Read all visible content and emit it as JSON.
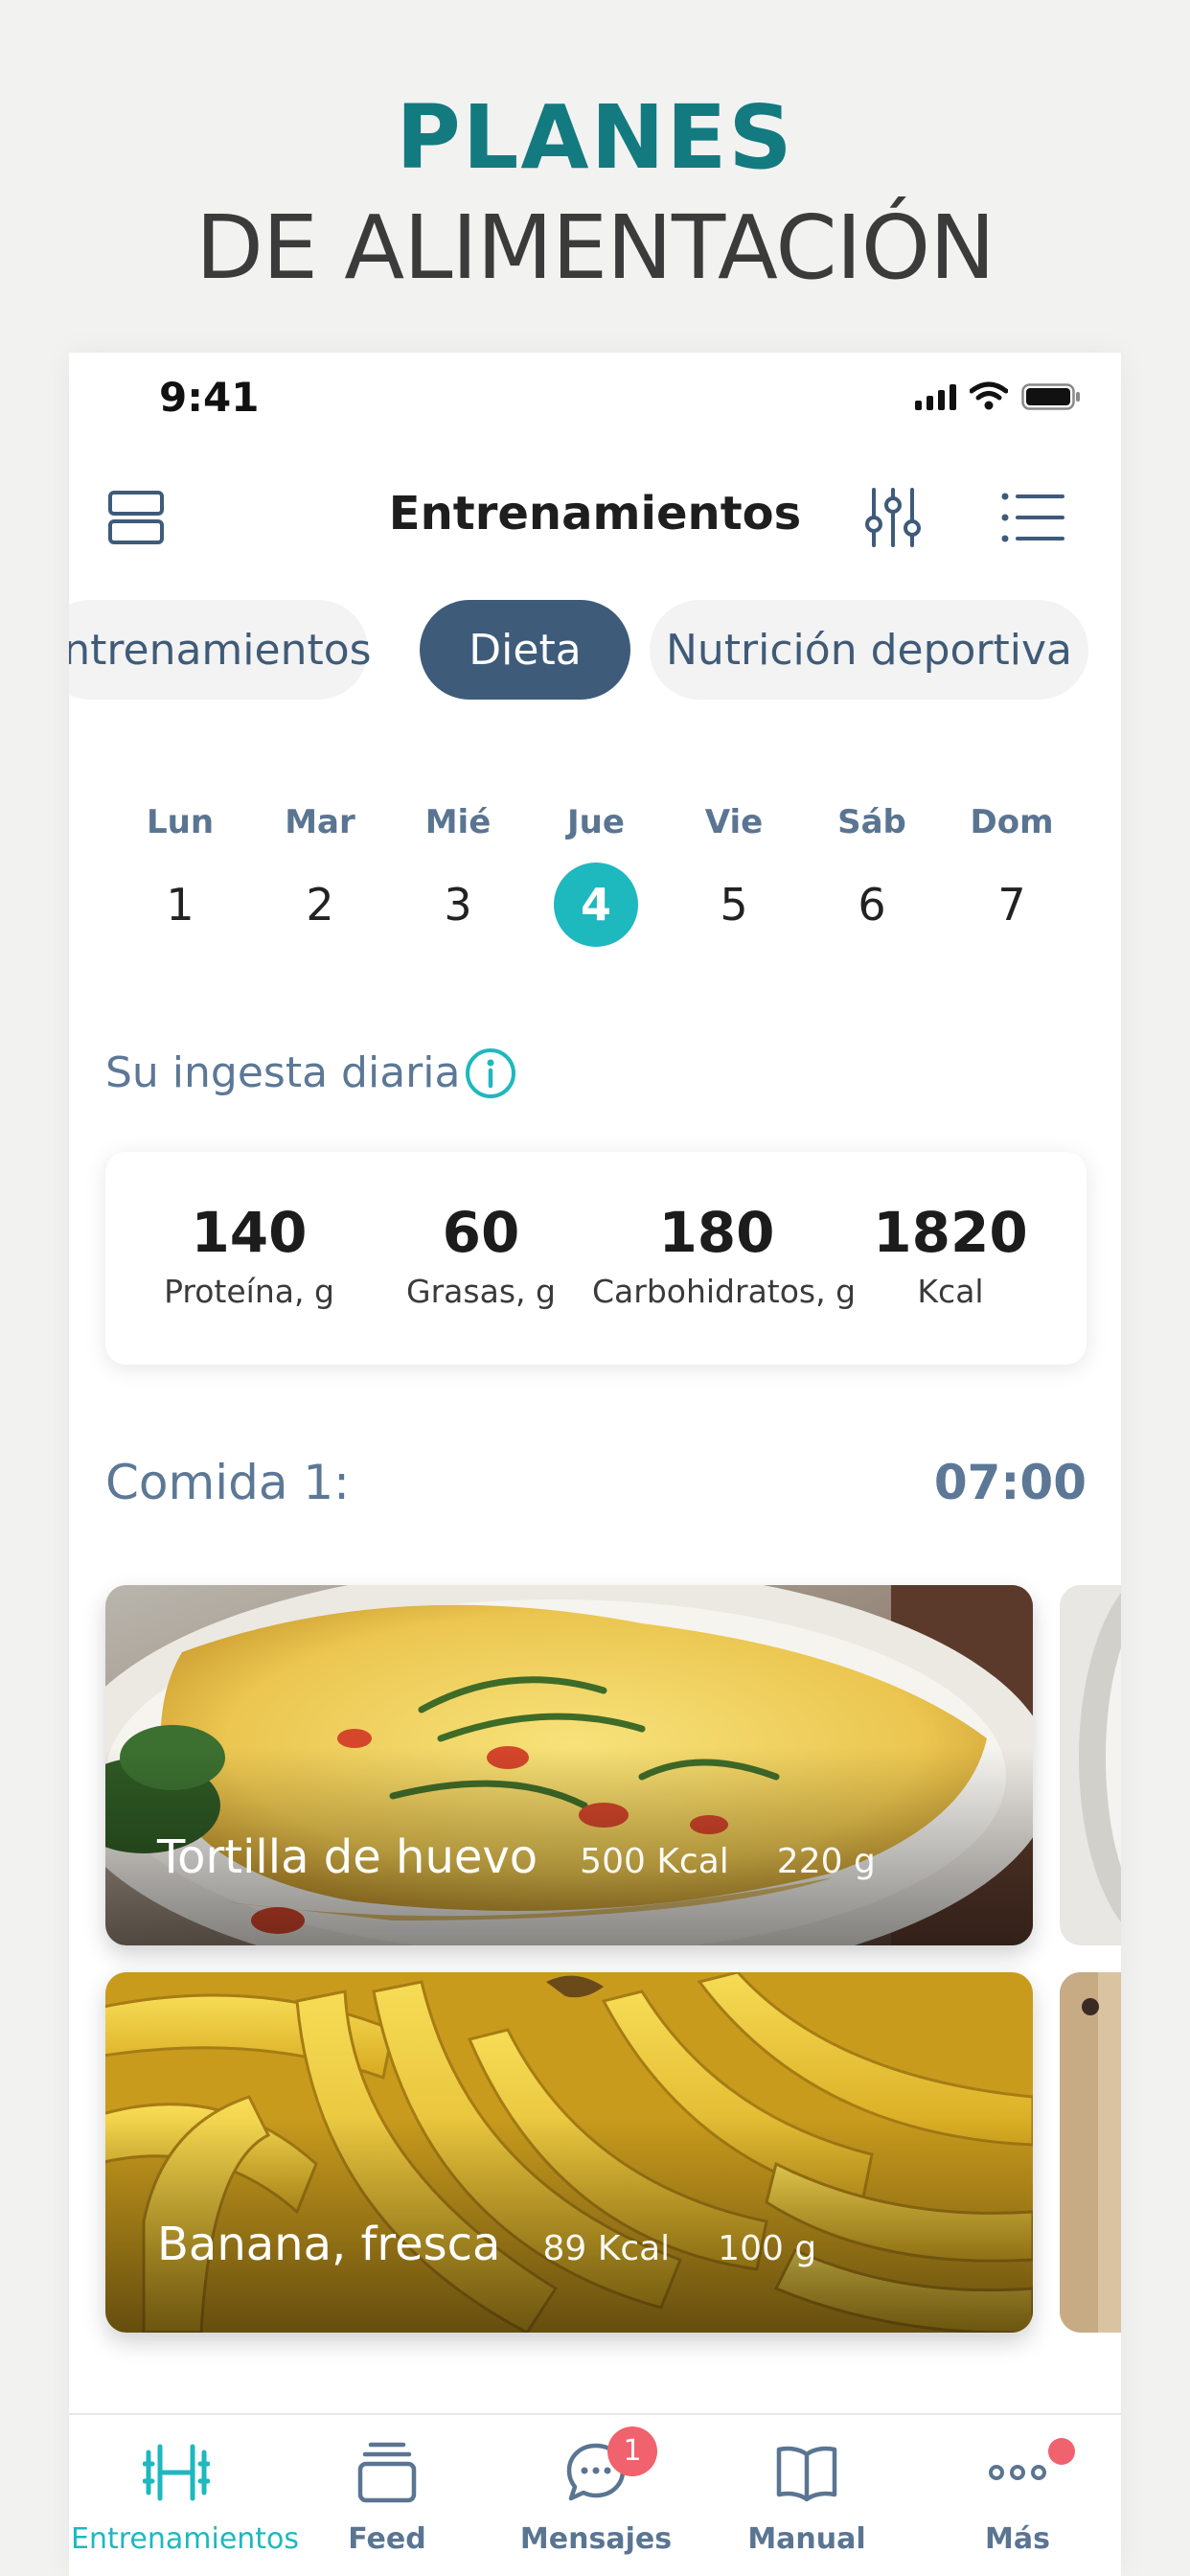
{
  "headline": {
    "line1": "PLANES",
    "line2": "DE ALIMENTACIÓN"
  },
  "status_bar": {
    "time": "9:41"
  },
  "header": {
    "title": "Entrenamientos"
  },
  "chips": [
    {
      "label": "Entrenamientos",
      "active": false
    },
    {
      "label": "Dieta",
      "active": true
    },
    {
      "label": "Nutrición deportiva",
      "active": false
    }
  ],
  "week": {
    "days": [
      {
        "name": "Lun",
        "num": "1"
      },
      {
        "name": "Mar",
        "num": "2"
      },
      {
        "name": "Mié",
        "num": "3"
      },
      {
        "name": "Jue",
        "num": "4"
      },
      {
        "name": "Vie",
        "num": "5"
      },
      {
        "name": "Sáb",
        "num": "6"
      },
      {
        "name": "Dom",
        "num": "7"
      }
    ],
    "selected": "4"
  },
  "intake": {
    "title": "Su ingesta diaria",
    "stats": [
      {
        "value": "140",
        "label": "Proteína, g"
      },
      {
        "value": "60",
        "label": "Grasas, g"
      },
      {
        "value": "180",
        "label": "Carbohidratos, g"
      },
      {
        "value": "1820",
        "label": "Kcal"
      }
    ]
  },
  "meal": {
    "label": "Comida 1:",
    "time": "07:00",
    "foods": [
      {
        "name": "Tortilla de huevo",
        "kcal": "500 Kcal",
        "weight": "220 g"
      },
      {
        "name": "Banana, fresca",
        "kcal": "89 Kcal",
        "weight": "100 g"
      }
    ]
  },
  "tabbar": {
    "items": [
      {
        "label": "Entrenamientos",
        "icon": "dumbbell-icon",
        "active": true
      },
      {
        "label": "Feed",
        "icon": "stack-icon"
      },
      {
        "label": "Mensajes",
        "icon": "chat-bubble-icon",
        "badge": "1"
      },
      {
        "label": "Manual",
        "icon": "book-icon"
      },
      {
        "label": "Más",
        "icon": "more-dots-icon"
      }
    ]
  },
  "colors": {
    "accent": "#1eb8bf",
    "primary": "#3e5b7a",
    "headline": "#137a80",
    "badge": "#f0626d"
  }
}
